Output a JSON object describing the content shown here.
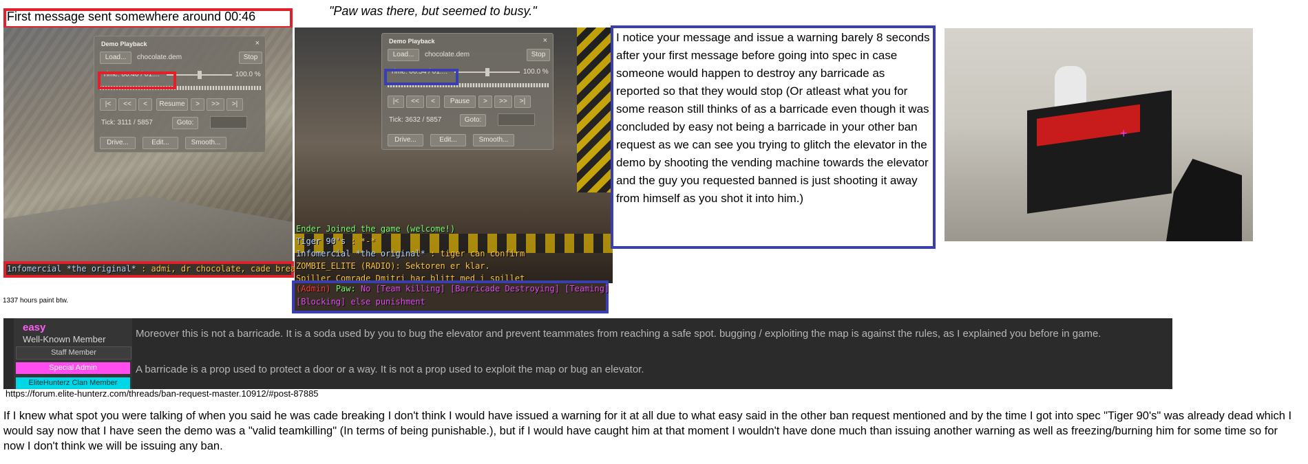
{
  "top_caption": "First message sent somewhere around 00:46",
  "quote_caption": "\"Paw was there, but seemed to busy.\"",
  "panel1": {
    "demo": {
      "title": "Demo Playback",
      "close": "×",
      "load": "Load...",
      "file": "chocolate.dem",
      "stop": "Stop",
      "time": "Time: 00:46 / 01:...",
      "speed": "100.0 %",
      "btn_start": "|<",
      "btn_rew": "<<",
      "btn_back": "<",
      "btn_play": "Resume",
      "btn_fwd": ">",
      "btn_ff": ">>",
      "btn_end": ">|",
      "tick": "Tick: 3111 / 5857",
      "goto": "Goto:",
      "drive": "Drive...",
      "edit": "Edit...",
      "smooth": "Smooth...",
      "progress": 0.55
    },
    "chat_name": "1nfomercial *the original*",
    "chat_msg": " :  admi, dr chocolate, cade breaks"
  },
  "hours_note": "1337 hours paint btw.",
  "panel2": {
    "demo": {
      "title": "Demo Playback",
      "close": "×",
      "load": "Load...",
      "file": "chocolate.dem",
      "stop": "Stop",
      "time": "Time: 00:54 / 01:...",
      "speed": "100.0 %",
      "btn_start": "|<",
      "btn_rew": "<<",
      "btn_back": "<",
      "btn_play": "Pause",
      "btn_fwd": ">",
      "btn_ff": ">>",
      "btn_end": ">|",
      "tick": "Tick: 3632 / 5857",
      "goto": "Goto:",
      "drive": "Drive...",
      "edit": "Edit...",
      "smooth": "Smooth...",
      "progress": 0.62
    },
    "chat": [
      {
        "text": "Ender Joined the game (welcome!)",
        "color": "#7dff6a"
      },
      {
        "name": "Tiger 90's",
        "name_color": "#b9d8ff",
        "msg": " :  *-*",
        "msg_color": "#ffc83c"
      },
      {
        "name": "1nfomercial *the original*",
        "name_color": "#b9d8ff",
        "msg": " :  tiger can confirm",
        "msg_color": "#ffc83c"
      },
      {
        "text": "ZOMBIE_ELITE (RADIO): Sektoren er klar.",
        "color": "#ffc83c"
      },
      {
        "text": "Spiller Comrade Dmitri har blitt med i spillet",
        "color": "#ffc83c"
      }
    ],
    "admin_tag": "(Admin)",
    "admin_name": "Paw:",
    "admin_line1": " No [Team killing] [Barricade Destroying] [Teaming]",
    "admin_line2": "[Blocking] else punishment"
  },
  "explanation": "I notice your message and issue a warning barely 8 seconds after your first message before going into spec in case someone would happen to destroy any barricade as reported so that they would stop (Or atleast what you for some reason still thinks of as a barricade even though it was concluded by easy not being a barricade in your other ban request as we can see you trying to glitch the elevator in the demo by shooting the vending machine towards the elevator and the guy you requested banned is just shooting it away from himself as you shot it into him.)",
  "forum": {
    "username": "easy",
    "user_title": "Well-Known Member",
    "badges": [
      {
        "label": "Staff Member",
        "bg": "#3d3d3d",
        "fg": "#cfcfcf"
      },
      {
        "label": "Special Admin",
        "bg": "#ff4df0",
        "fg": "#ffffff"
      },
      {
        "label": "EliteHunterz Clan Member",
        "bg": "#00d7e6",
        "fg": "#11303a"
      }
    ],
    "message1": "Moreover this is not a barricade. It is a soda used by you to bug the elevator and prevent teammates from reaching a safe spot. bugging / exploiting the map is against the rules, as I explained you before in game.",
    "message2": "A barricade is a prop used to protect a door or a way. It is not a prop used to exploit the map or bug an elevator."
  },
  "forum_url": "https://forum.elite-hunterz.com/threads/ban-request-master.10912/#post-87885",
  "conclusion": "If I knew what spot you were talking of when you said he was cade breaking I don't think I would have issued a warning for it at all due to what easy said in the other ban request mentioned and by the time I got into spec \"Tiger 90's\" was already dead which I would say now that I have seen the demo was a \"valid teamkilling\" (In terms of being punishable.), but if I would have caught him at that moment I wouldn't have done much than issuing another warning as well as freezing/burning him for some time so for now I don't think we will be issuing any ban."
}
